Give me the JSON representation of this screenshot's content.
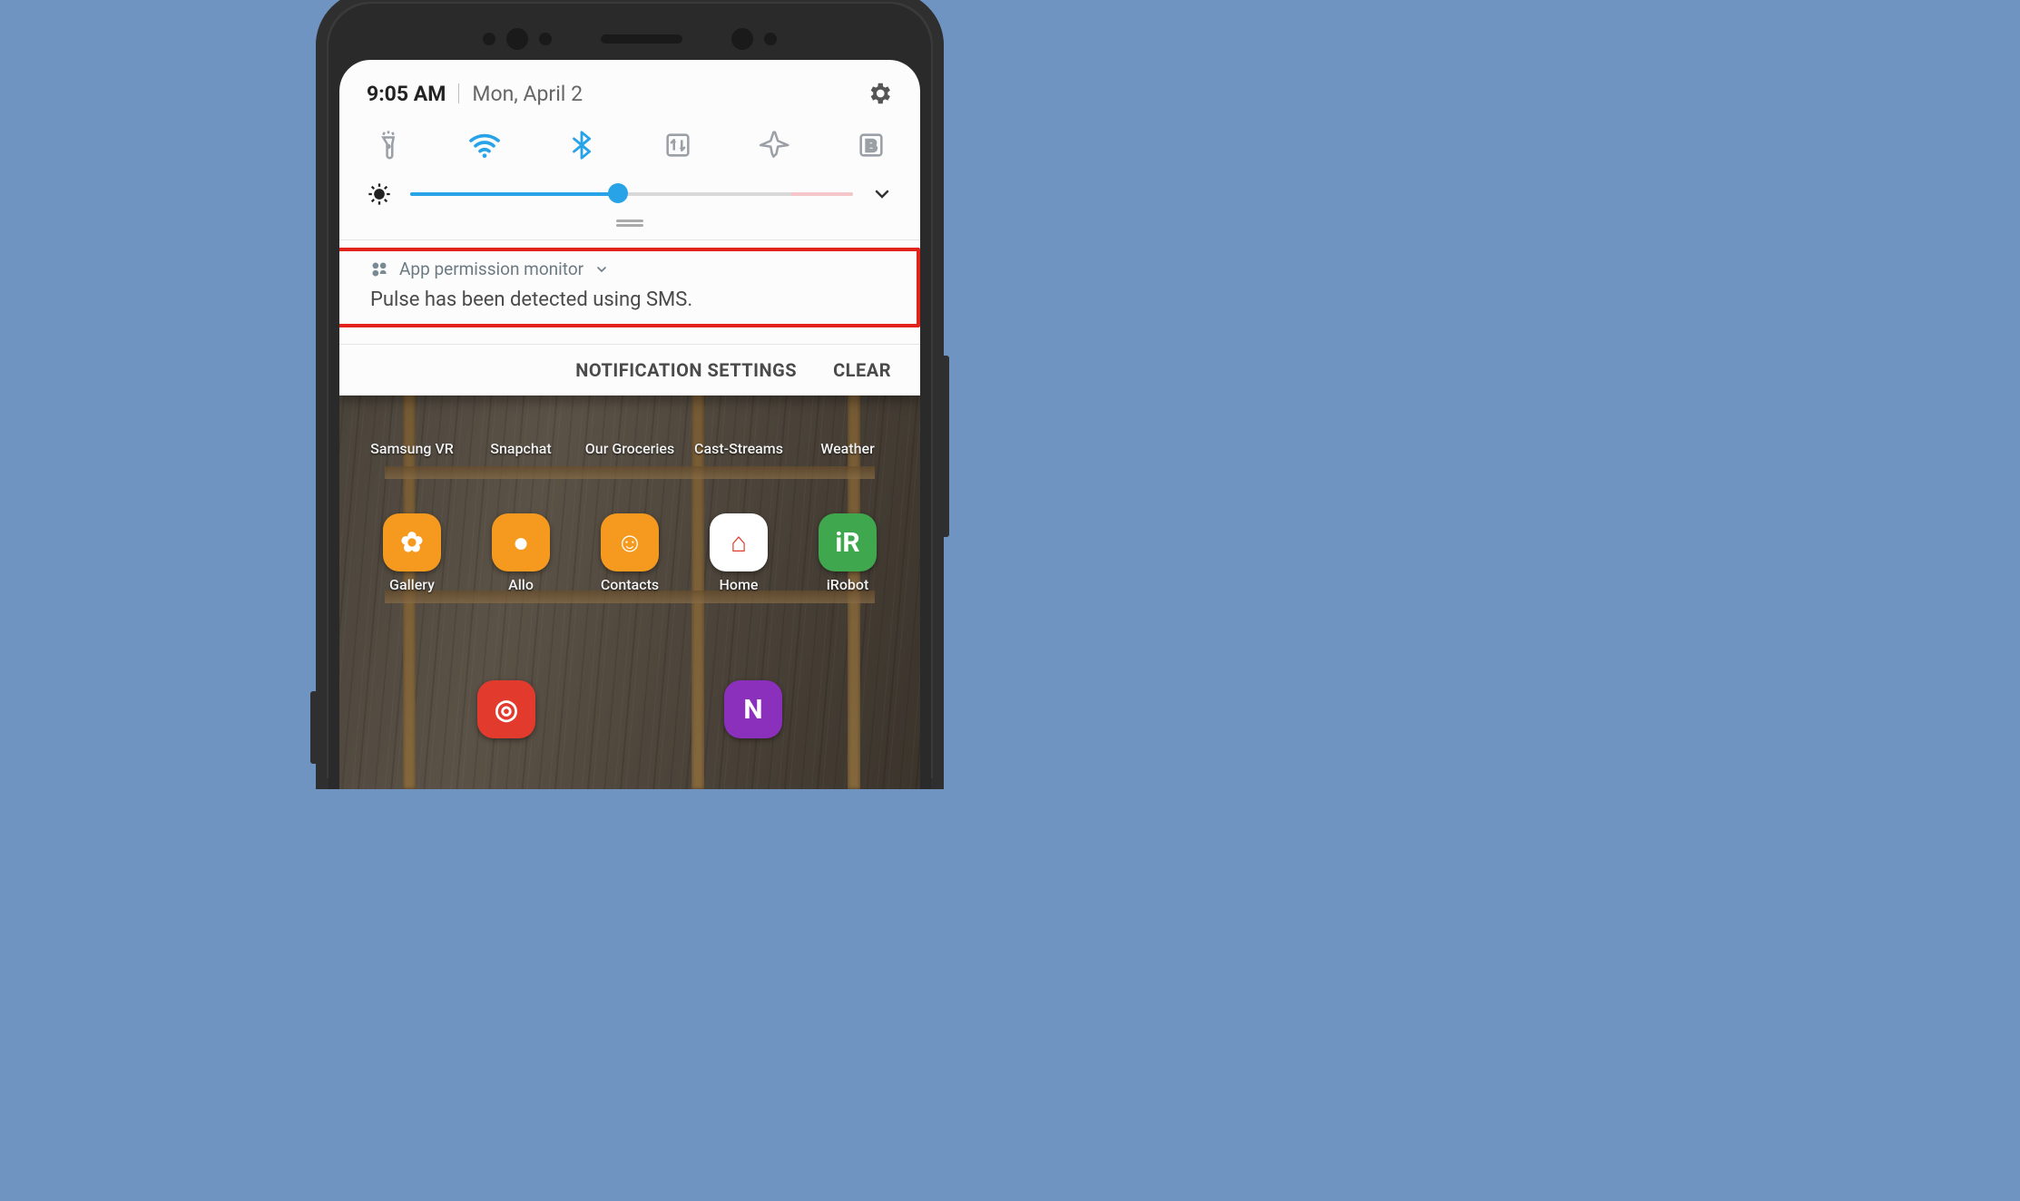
{
  "statusbar": {
    "time": "9:05 AM",
    "date": "Mon, April 2"
  },
  "quicksettings": {
    "items": [
      {
        "name": "flashlight",
        "active": false
      },
      {
        "name": "wifi",
        "active": true
      },
      {
        "name": "bluetooth",
        "active": true
      },
      {
        "name": "rotate",
        "active": false
      },
      {
        "name": "airplane",
        "active": false
      },
      {
        "name": "blue-light-filter",
        "active": false,
        "letter": "B"
      }
    ],
    "brightness_percent": 47
  },
  "notification": {
    "app": "App permission monitor",
    "body": "Pulse has been detected using SMS."
  },
  "actions": {
    "settings": "NOTIFICATION SETTINGS",
    "clear": "CLEAR"
  },
  "homescreen": {
    "row1": [
      {
        "label": "Samsung VR"
      },
      {
        "label": "Snapchat"
      },
      {
        "label": "Our Groceries"
      },
      {
        "label": "Cast-Streams"
      },
      {
        "label": "Weather"
      }
    ],
    "row2": [
      {
        "label": "Gallery",
        "bg": "#f59a1f",
        "glyph": "✿"
      },
      {
        "label": "Allo",
        "bg": "#f59a1f",
        "glyph": "●"
      },
      {
        "label": "Contacts",
        "bg": "#f59a1f",
        "glyph": "☺"
      },
      {
        "label": "Home",
        "bg": "#ffffff",
        "glyph": "⌂"
      },
      {
        "label": "iRobot",
        "bg": "#3fa84e",
        "glyph": "iR"
      }
    ],
    "row3": [
      {
        "label": "",
        "bg": "#e23b2e",
        "glyph": "◎"
      },
      {
        "label": "",
        "bg": "#8b2fbd",
        "glyph": "N"
      }
    ]
  },
  "colors": {
    "accent": "#29a3e8",
    "icon_inactive": "#9aa0a6",
    "highlight": "#e1231b"
  }
}
